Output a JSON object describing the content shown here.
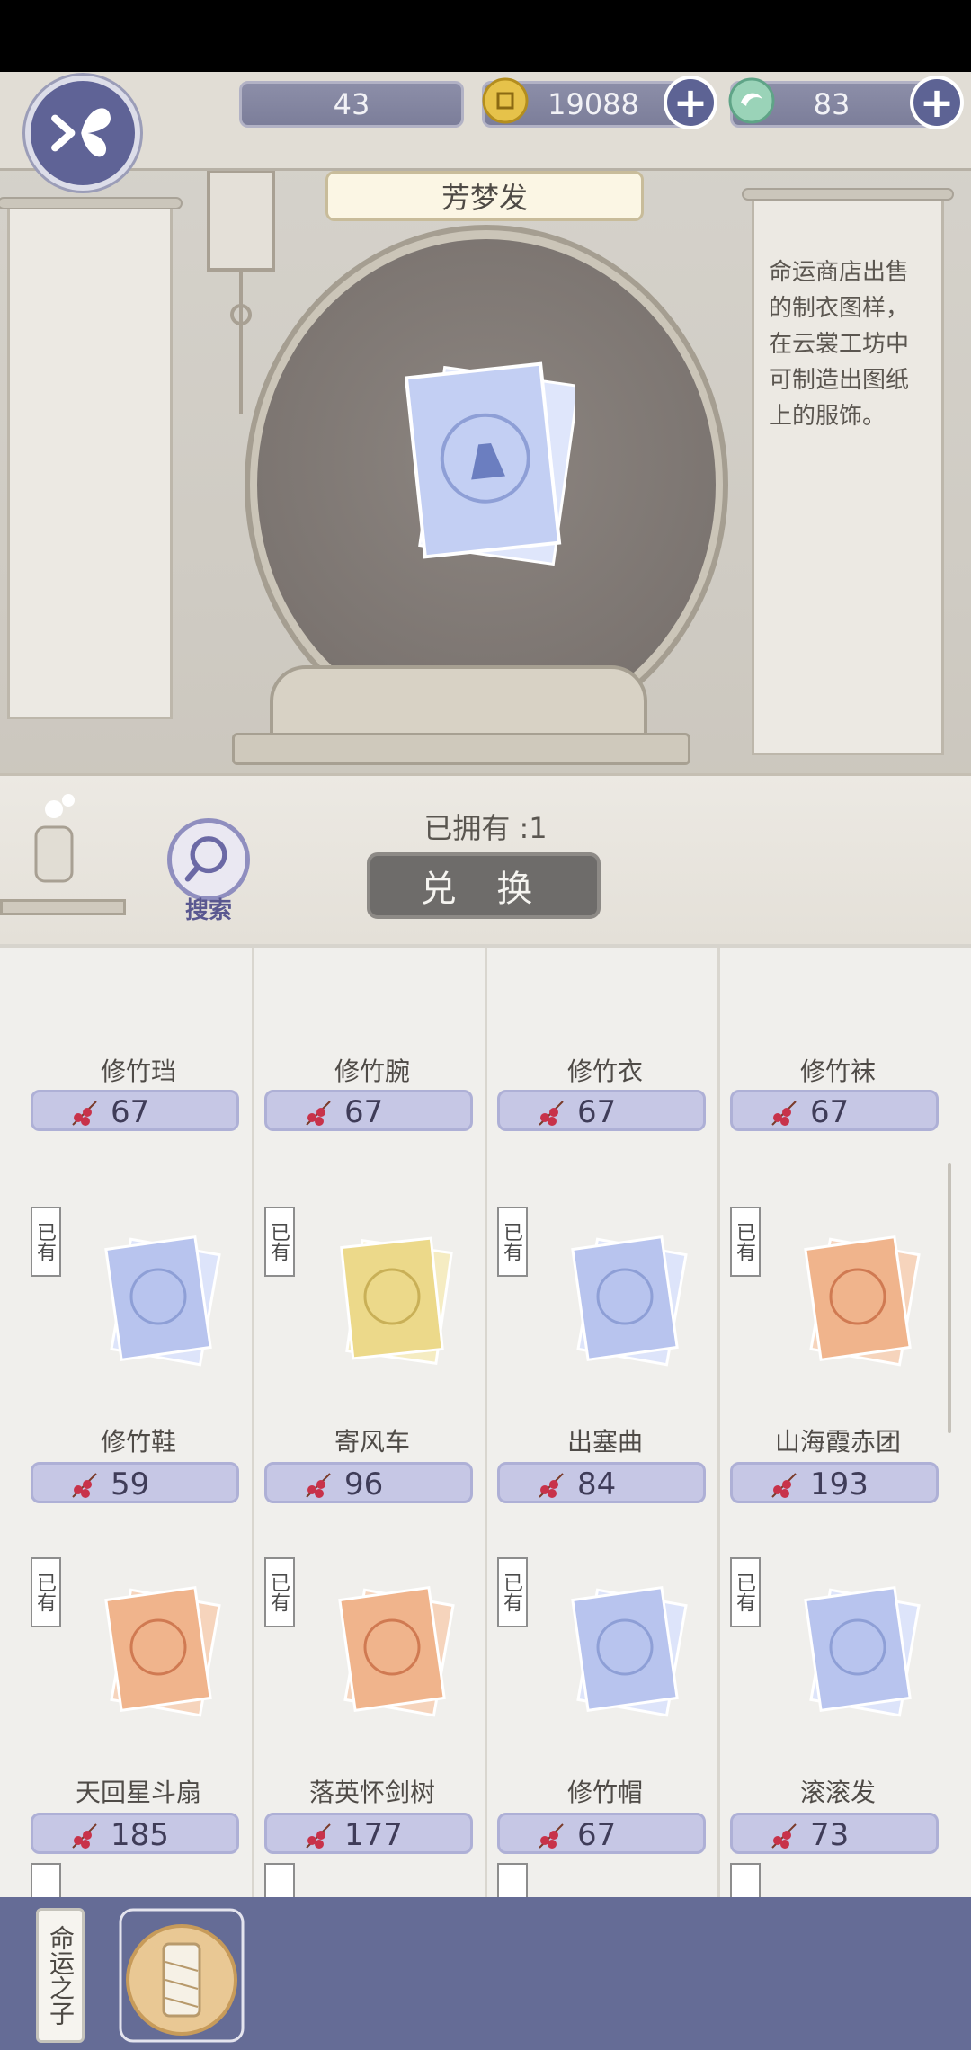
{
  "topbar": {
    "berries": "43",
    "coins": "19088",
    "jade": "83"
  },
  "item": {
    "name": "芳梦发",
    "description": "命运商店出售的制衣图样，在云裳工坊中可制造出图纸上的服饰。",
    "owned": "已拥有 :1",
    "exchange_label": "兑 换"
  },
  "search_label": "搜索",
  "shop": {
    "owned_tag": "已有",
    "rows": [
      [
        {
          "name": "修竹珰",
          "price": "67"
        },
        {
          "name": "修竹腕",
          "price": "67"
        },
        {
          "name": "修竹衣",
          "price": "67"
        },
        {
          "name": "修竹袜",
          "price": "67"
        }
      ],
      [
        {
          "name": "修竹鞋",
          "price": "59",
          "paper": "blue"
        },
        {
          "name": "寄风车",
          "price": "96",
          "paper": "yellow"
        },
        {
          "name": "出塞曲",
          "price": "84",
          "paper": "blue"
        },
        {
          "name": "山海霞赤团",
          "price": "193",
          "paper": "orange"
        }
      ],
      [
        {
          "name": "天回星斗扇",
          "price": "185",
          "paper": "orange"
        },
        {
          "name": "落英怀剑树",
          "price": "177",
          "paper": "orange"
        },
        {
          "name": "修竹帽",
          "price": "67",
          "paper": "blue"
        },
        {
          "name": "滚滚发",
          "price": "73",
          "paper": "blue"
        }
      ]
    ]
  },
  "bottom": {
    "tab_label": "命运之子"
  },
  "colors": {
    "accent": "#5d6394",
    "price_bg": "#c6c7e5",
    "paper_blue": "#b8c4ee",
    "paper_yellow": "#ecd98a",
    "paper_orange": "#f0b48c"
  }
}
